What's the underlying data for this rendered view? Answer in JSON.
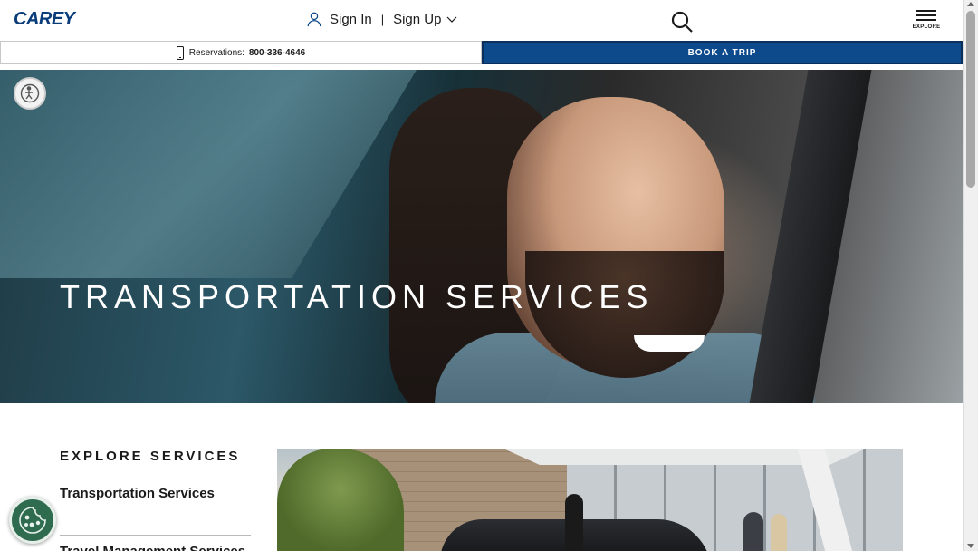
{
  "header": {
    "logo": "CAREY",
    "sign_in": "Sign In",
    "separator": "|",
    "sign_up": "Sign Up",
    "explore_label": "EXPLORE"
  },
  "strip": {
    "reservations_label": "Reservations:",
    "reservations_number": "800-336-4646",
    "book_trip": "BOOK A TRIP"
  },
  "hero": {
    "title": "TRANSPORTATION SERVICES"
  },
  "services": {
    "heading": "EXPLORE SERVICES",
    "items": [
      {
        "label": "Transportation Services"
      },
      {
        "label": "Travel Management Services"
      }
    ]
  },
  "colors": {
    "brand_blue": "#0d4a8c",
    "cookie_green": "#2f6b4f"
  },
  "icons": {
    "user": "user-icon",
    "chevron": "chevron-down-icon",
    "search": "search-icon",
    "menu": "hamburger-menu-icon",
    "phone": "phone-icon",
    "accessibility": "accessibility-icon",
    "cookie": "cookie-icon"
  }
}
